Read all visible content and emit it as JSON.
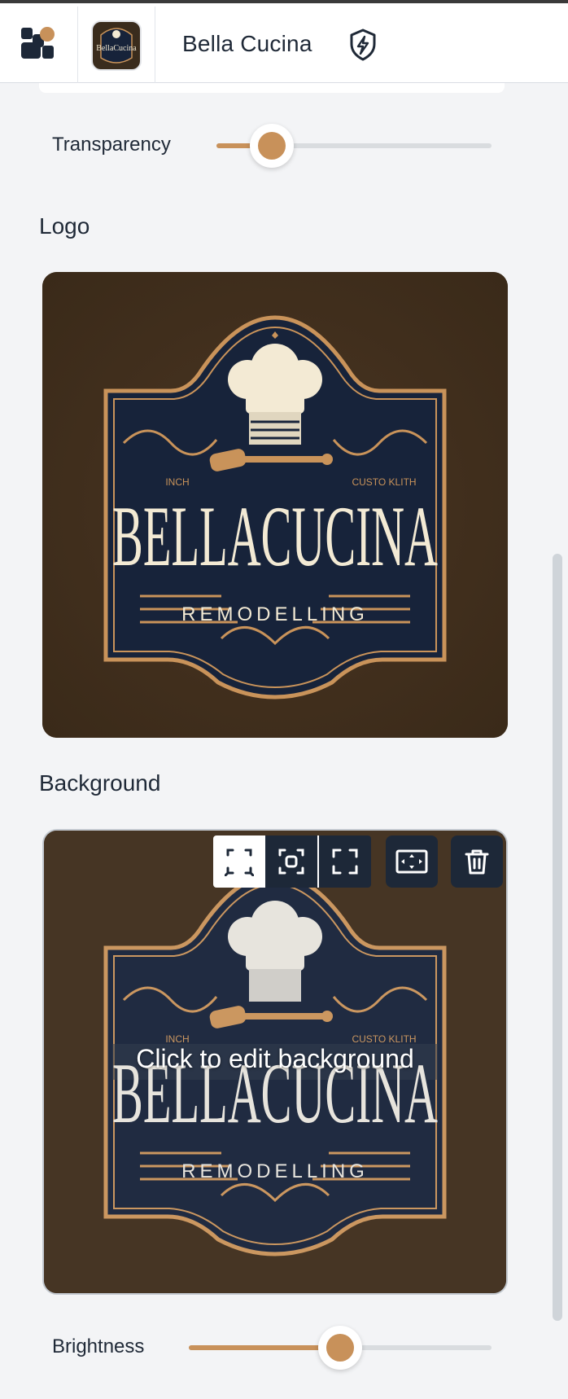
{
  "header": {
    "brand_name": "Bella Cucina",
    "app_logo_icon": "app-logo-icon",
    "shield_icon": "shield-bolt-icon",
    "thumbnail_text": "BellaCucina"
  },
  "transparency": {
    "label": "Transparency",
    "value": 0.2
  },
  "logo_section": {
    "title": "Logo",
    "logo_text_main": "BELLACUCINA",
    "logo_text_sub": "REMODELLING",
    "logo_text_left": "INCH",
    "logo_text_right": "CUSTO KLITH"
  },
  "background_section": {
    "title": "Background",
    "overlay_caption": "Click to edit background",
    "toolbar": [
      {
        "icon": "crop-icon",
        "active": true
      },
      {
        "icon": "focus-icon",
        "active": false
      },
      {
        "icon": "expand-icon",
        "active": false
      },
      {
        "icon": "fit-icon",
        "active": false
      },
      {
        "icon": "trash-icon",
        "active": false
      }
    ]
  },
  "brightness": {
    "label": "Brightness",
    "value": 0.5
  },
  "colors": {
    "accent": "#c8915a",
    "dark_navy": "#1d2838",
    "card_brown": "#3f2d1c",
    "cream": "#f3ead4",
    "gold": "#c9935a"
  }
}
